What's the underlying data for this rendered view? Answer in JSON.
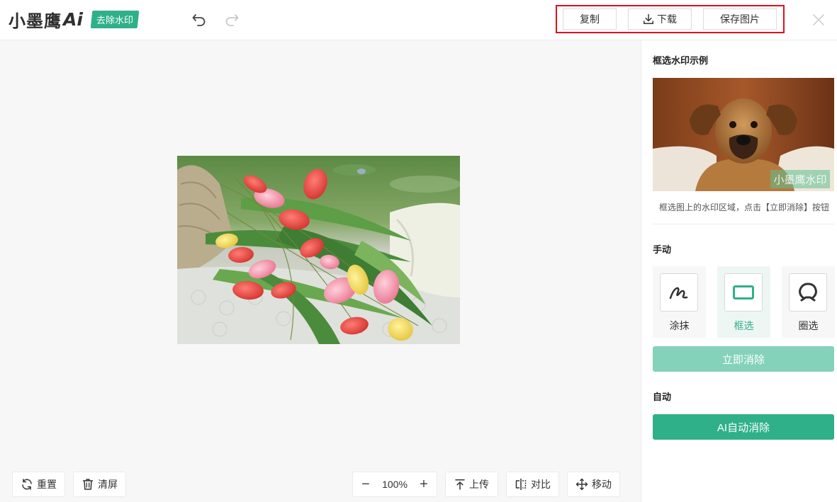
{
  "header": {
    "logo_text": "小墨鹰",
    "logo_ai": "Ai",
    "badge": "去除水印",
    "undo_icon": "undo-icon",
    "redo_icon": "redo-icon",
    "actions": {
      "copy": "复制",
      "download": "下载",
      "save_image": "保存图片"
    },
    "close_icon": "close-icon"
  },
  "canvas": {
    "image_subject": "tulip bouquet",
    "reset": "重置",
    "clear": "清屏",
    "zoom": "100%",
    "upload": "上传",
    "compare": "对比",
    "move": "移动"
  },
  "panel": {
    "example_title": "框选水印示例",
    "example_watermark": "小墨鹰水印",
    "example_caption": "框选图上的水印区域，点击【立即消除】按钮",
    "manual_title": "手动",
    "tools": [
      {
        "label": "涂抹",
        "icon": "brush-icon",
        "active": false
      },
      {
        "label": "框选",
        "icon": "rectangle-select-icon",
        "active": true
      },
      {
        "label": "圈选",
        "icon": "lasso-icon",
        "active": false
      }
    ],
    "erase_now": "立即消除",
    "auto_title": "自动",
    "ai_erase": "AI自动消除"
  },
  "colors": {
    "accent": "#2fb089",
    "accent_light": "#84d2b9",
    "highlight_border": "#e0101e"
  }
}
